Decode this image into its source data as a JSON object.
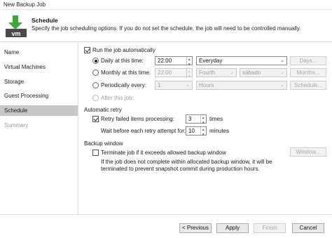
{
  "window": {
    "title": "New Backup Job"
  },
  "header": {
    "title": "Schedule",
    "description": "Specify the job scheduling options. If you do not set the schedule, the job will need to be controlled manually.",
    "logo_text": "vm"
  },
  "sidebar": {
    "items": [
      {
        "label": "Name",
        "state": "normal"
      },
      {
        "label": "Virtual Machines",
        "state": "normal"
      },
      {
        "label": "Storage",
        "state": "normal"
      },
      {
        "label": "Guest Processing",
        "state": "normal"
      },
      {
        "label": "Schedule",
        "state": "active"
      },
      {
        "label": "Summary",
        "state": "disabled"
      }
    ]
  },
  "schedule": {
    "run_automatically": {
      "label": "Run the job automatically",
      "checked": true
    },
    "daily": {
      "label": "Daily at this time:",
      "selected": true,
      "time": "22:00",
      "frequency": "Everyday",
      "button": "Days..."
    },
    "monthly": {
      "label": "Monthly at this time:",
      "selected": false,
      "time": "22:00",
      "week": "Fourth",
      "day": "sábado",
      "button": "Months..."
    },
    "periodically": {
      "label": "Periodically every:",
      "selected": false,
      "value": "1",
      "unit": "Hours",
      "button": "Schedule..."
    },
    "after_job": {
      "label": "After this job:",
      "selected": false
    }
  },
  "retry": {
    "section_title": "Automatic retry",
    "retry_failed": {
      "label": "Retry failed items processing:",
      "checked": true,
      "value": "3",
      "unit": "times"
    },
    "wait": {
      "label": "Wait before each retry attempt for:",
      "value": "10",
      "unit": "minutes"
    }
  },
  "backup_window": {
    "section_title": "Backup window",
    "terminate": {
      "label": "Terminate job if it exceeds allowed backup window",
      "checked": false,
      "button": "Window..."
    },
    "note_line1": "If the job does not complete within allocated backup window, it will be",
    "note_line2": "terminated to prevent snapshot commit during production hours."
  },
  "footer": {
    "previous": "< Previous",
    "apply": "Apply",
    "finish": "Finish",
    "cancel": "Cancel"
  },
  "colors": {
    "logo_green": "#3aaa35",
    "logo_dark": "#4a4a4a",
    "active_nav": "#c8c8c8"
  }
}
